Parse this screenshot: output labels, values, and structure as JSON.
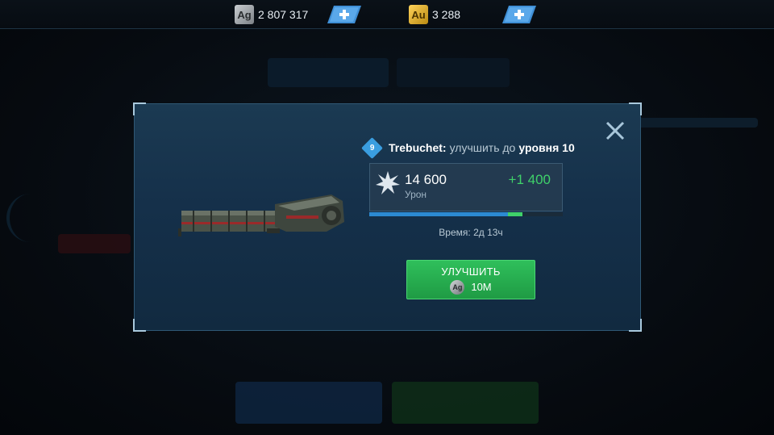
{
  "currency": {
    "silver": {
      "code": "Ag",
      "value": "2 807 317",
      "icon": "silver-coin-icon"
    },
    "gold": {
      "code": "Au",
      "value": "3 288",
      "icon": "gold-coin-icon"
    },
    "add_icon": "plus-icon"
  },
  "dialog": {
    "level_badge": "9",
    "item_name": "Trebuchet:",
    "title_mid": "улучшить до",
    "title_level": "уровня 10",
    "stat": {
      "icon": "damage-burst-icon",
      "value": "14 600",
      "label": "Урон",
      "bonus": "+1 400",
      "progress_current": 0.715,
      "progress_after": 0.79
    },
    "time_text": "Время: 2д 13ч",
    "upgrade": {
      "label": "УЛУЧШИТЬ",
      "cost_code": "Ag",
      "cost_value": "10M"
    },
    "close_icon": "close-icon",
    "weapon_image": "weapon-image"
  },
  "colors": {
    "accent_blue": "#3a9ee0",
    "upgrade_green": "#2fbf5b",
    "bonus_green": "#3fd16a",
    "modal_bg": "#1b3a52"
  }
}
